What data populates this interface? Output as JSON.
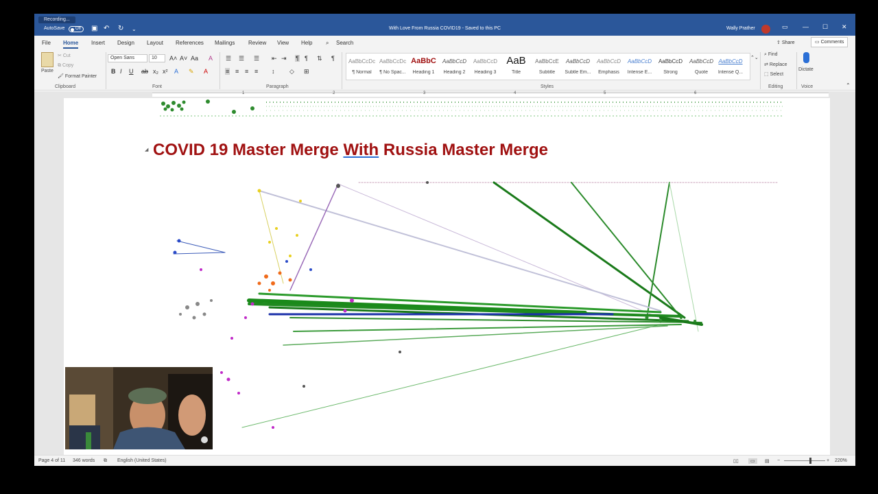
{
  "titlebar": {
    "recording": "Recording...",
    "autosave_label": "AutoSave",
    "autosave_state": "Off",
    "doc_title": "With Love From Russia COVID19 - Saved to this PC",
    "user": "Wally Prather"
  },
  "tabs": [
    "File",
    "Home",
    "Insert",
    "Design",
    "Layout",
    "References",
    "Mailings",
    "Review",
    "View",
    "Help"
  ],
  "search_label": "Search",
  "share_label": "Share",
  "comments_label": "Comments",
  "clipboard": {
    "paste": "Paste",
    "cut": "Cut",
    "copy": "Copy",
    "format_painter": "Format Painter",
    "group": "Clipboard"
  },
  "font": {
    "name": "Open Sans",
    "size": "10",
    "group": "Font"
  },
  "paragraph": {
    "group": "Paragraph"
  },
  "styles": {
    "group": "Styles",
    "items": [
      {
        "preview": "AaBbCcDc",
        "name": "¶ Normal"
      },
      {
        "preview": "AaBbCcDc",
        "name": "¶ No Spac..."
      },
      {
        "preview": "AaBbC",
        "name": "Heading 1"
      },
      {
        "preview": "AaBbCcD",
        "name": "Heading 2"
      },
      {
        "preview": "AaBbCcD",
        "name": "Heading 3"
      },
      {
        "preview": "AaB",
        "name": "Title"
      },
      {
        "preview": "AaBbCcE",
        "name": "Subtitle"
      },
      {
        "preview": "AaBbCcD",
        "name": "Subtle Em..."
      },
      {
        "preview": "AaBbCcD",
        "name": "Emphasis"
      },
      {
        "preview": "AaBbCcD",
        "name": "Intense E..."
      },
      {
        "preview": "AaBbCcD",
        "name": "Strong"
      },
      {
        "preview": "AaBbCcD",
        "name": "Quote"
      },
      {
        "preview": "AaBbCcD",
        "name": "Intense Q..."
      }
    ]
  },
  "editing": {
    "find": "Find",
    "replace": "Replace",
    "select": "Select",
    "group": "Editing"
  },
  "voice": {
    "dictate": "Dictate",
    "group": "Voice"
  },
  "ruler_numbers": [
    "1",
    "2",
    "3",
    "4",
    "5",
    "6"
  ],
  "document": {
    "heading_part1": "COVID 19 Master Merge ",
    "heading_with": "With",
    "heading_part2": " Russia Master Merge"
  },
  "status": {
    "page": "Page 4 of 11",
    "words": "346 words",
    "language": "English (United States)",
    "zoom": "220%"
  },
  "colors": {
    "title_bar": "#2b579a",
    "heading": "#a01111",
    "graph_green": "#1f8a1f",
    "graph_blue": "#1a2fa8",
    "graph_magenta": "#c02ac8",
    "graph_orange": "#f06a1a"
  }
}
